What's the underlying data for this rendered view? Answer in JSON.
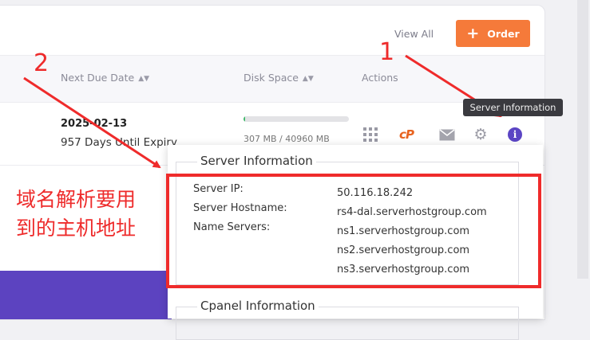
{
  "header": {
    "view_all": "View All",
    "order_label": "Order",
    "order_icon": "+"
  },
  "table": {
    "columns": [
      {
        "label": "Next Due Date",
        "sortable": true
      },
      {
        "label": "Disk Space",
        "sortable": true
      },
      {
        "label": "Actions",
        "sortable": false
      }
    ],
    "row": {
      "due_date": "2025-02-13",
      "expiry": "957 Days Until Expiry",
      "disk_usage_text": "307 MB / 40960 MB",
      "disk_used_fraction": 0.0075
    }
  },
  "actions": {
    "icons": [
      "grid-icon",
      "cpanel-icon",
      "mail-icon",
      "gear-icon",
      "info-icon"
    ],
    "cpanel_glyph": "cP",
    "info_glyph": "i"
  },
  "tooltip": "Server Information",
  "server_info": {
    "title": "Server Information",
    "fields": [
      {
        "label": "Server IP:",
        "value": "50.116.18.242"
      },
      {
        "label": "Server Hostname:",
        "value": "rs4-dal.serverhostgroup.com"
      },
      {
        "label": "Name Servers:",
        "value": "ns1.serverhostgroup.com"
      },
      {
        "label": "",
        "value": "ns2.serverhostgroup.com"
      },
      {
        "label": "",
        "value": "ns3.serverhostgroup.com"
      }
    ]
  },
  "cpanel_info": {
    "title": "Cpanel Information"
  },
  "annotation": {
    "text_line1": "域名解析要用",
    "text_line2": "到的主机地址",
    "num1": "1",
    "num2": "2"
  },
  "colors": {
    "accent": "#f57a3a",
    "primary": "#5b45c4",
    "annotation": "#ef2b2b",
    "disk_fill": "#3fb86a"
  }
}
